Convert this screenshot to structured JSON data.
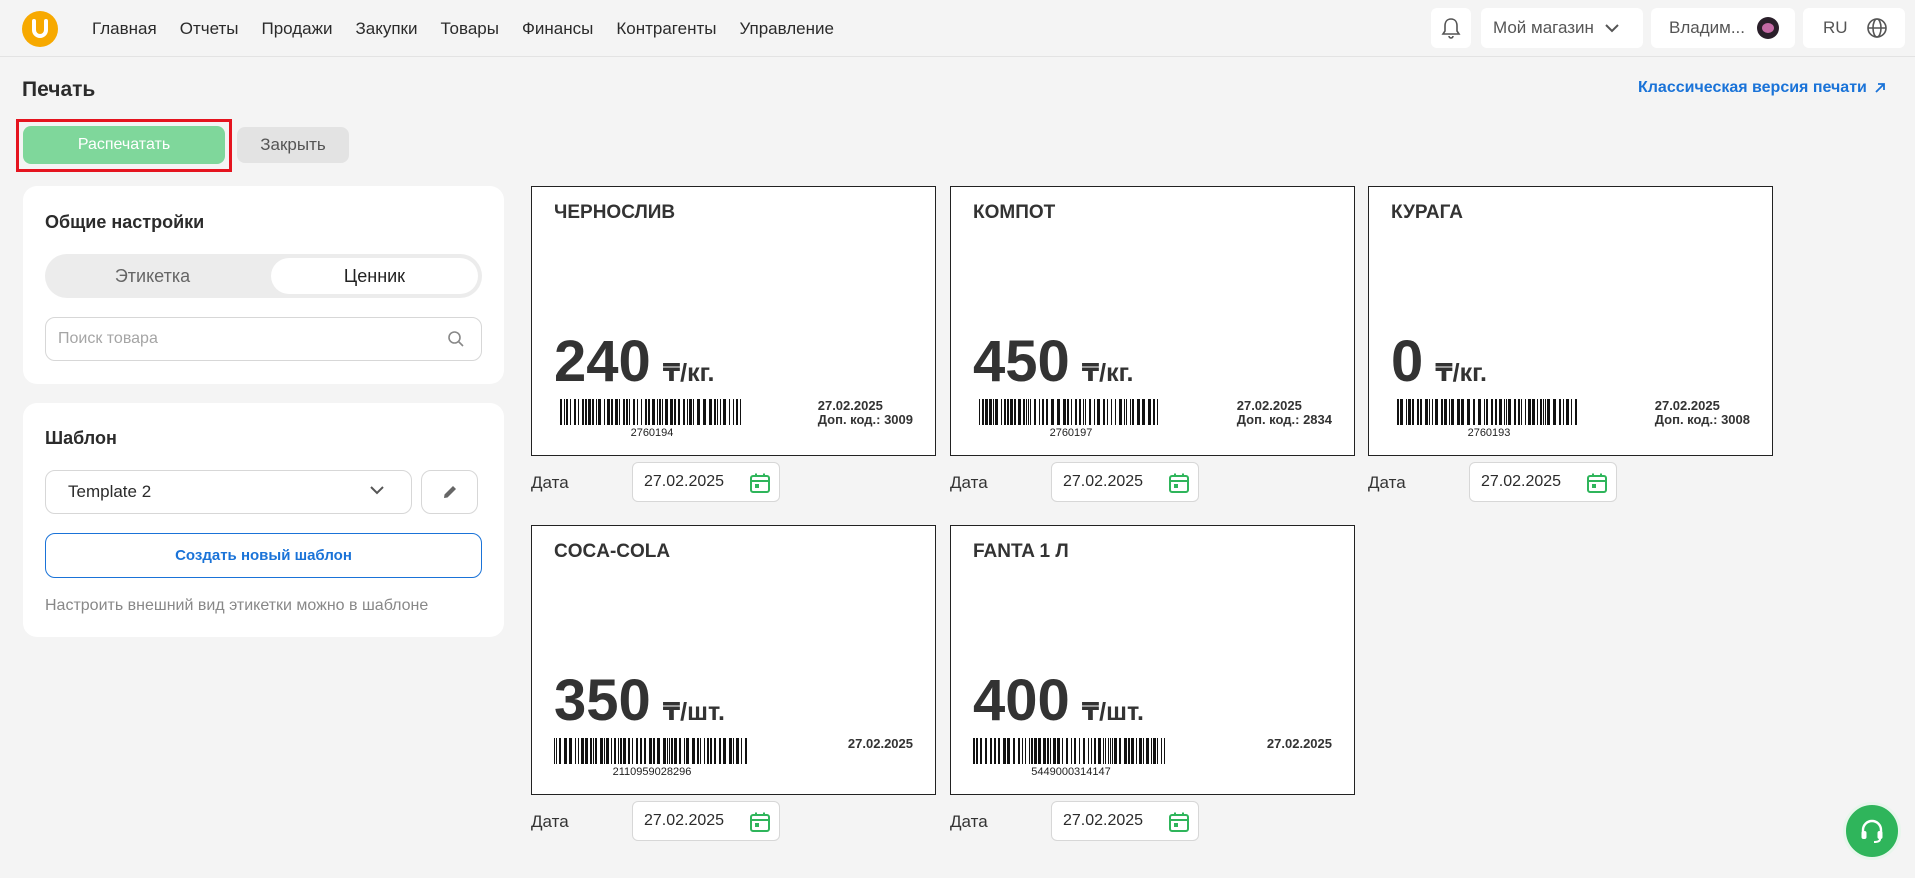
{
  "nav": {
    "items": [
      "Главная",
      "Отчеты",
      "Продажи",
      "Закупки",
      "Товары",
      "Финансы",
      "Контрагенты",
      "Управление"
    ],
    "store": "Мой магазин",
    "user": "Владим...",
    "lang": "RU"
  },
  "page": {
    "title": "Печать",
    "classic_link": "Классическая версия печати",
    "print_label": "Распечатать",
    "close_label": "Закрыть"
  },
  "settings": {
    "title": "Общие настройки",
    "tab_label": "Этикетка",
    "tab_price": "Ценник",
    "search_placeholder": "Поиск товара"
  },
  "template": {
    "title": "Шаблон",
    "selected": "Template 2",
    "create_label": "Создать новый шаблон",
    "hint": "Настроить внешний вид этикетки можно в шаблоне"
  },
  "date_label": "Дата",
  "labels": [
    {
      "name": "ЧЕРНОСЛИВ",
      "price": "240",
      "unit": "₸/кг.",
      "barcode": "2760194",
      "date": "27.02.2025",
      "code": "Доп. код.: 3009",
      "input_date": "27.02.2025"
    },
    {
      "name": "КОМПОТ",
      "price": "450",
      "unit": "₸/кг.",
      "barcode": "2760197",
      "date": "27.02.2025",
      "code": "Доп. код.: 2834",
      "input_date": "27.02.2025"
    },
    {
      "name": "КУРАГА",
      "price": "0",
      "unit": "₸/кг.",
      "barcode": "2760193",
      "date": "27.02.2025",
      "code": "Доп. код.: 3008",
      "input_date": "27.02.2025"
    },
    {
      "name": "COCA-COLA",
      "price": "350",
      "unit": "₸/шт.",
      "barcode": "2110959028296",
      "date": "27.02.2025",
      "input_date": "27.02.2025"
    },
    {
      "name": "FANTA 1 Л",
      "price": "400",
      "unit": "₸/шт.",
      "barcode": "5449000314147",
      "date": "27.02.2025",
      "input_date": "27.02.2025"
    }
  ],
  "colors": {
    "accent_green": "#7fd79b",
    "link_blue": "#1a73d8",
    "highlight_red": "#e5141f",
    "logo_orange": "#f7a900"
  }
}
